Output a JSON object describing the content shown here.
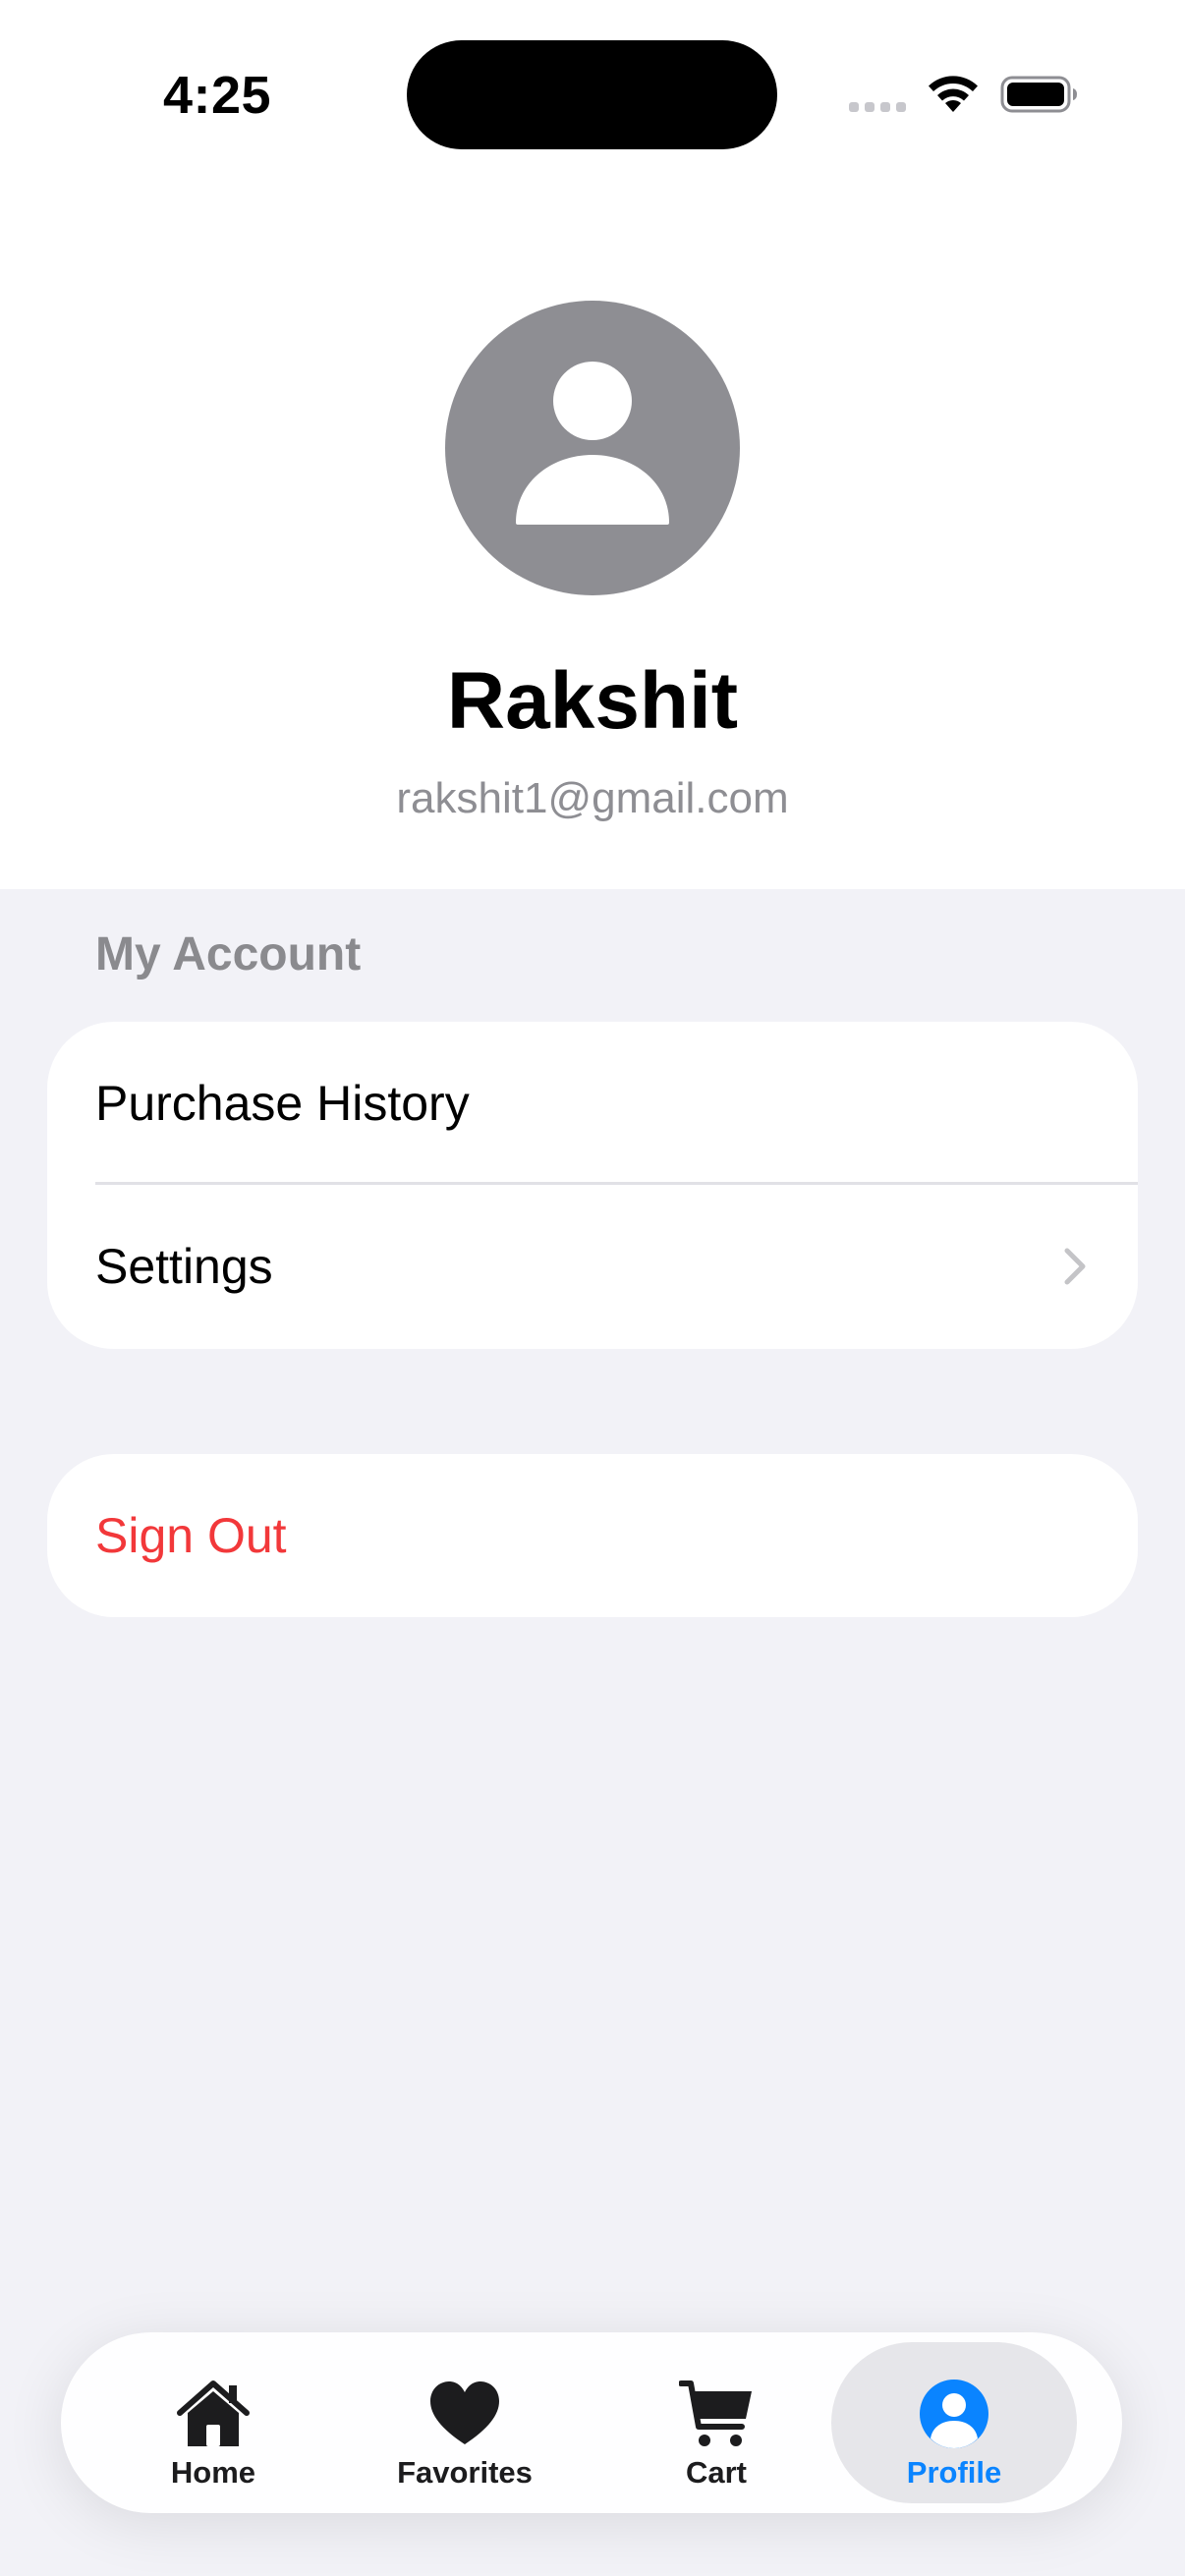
{
  "status_bar": {
    "time": "4:25"
  },
  "profile": {
    "name": "Rakshit",
    "email": "rakshit1@gmail.com",
    "avatar_icon": "person-circle-icon"
  },
  "sections": {
    "account": {
      "header": "My Account",
      "items": [
        {
          "label": "Purchase History"
        },
        {
          "label": "Settings",
          "icon": "chevron-right-icon"
        }
      ]
    },
    "sign_out": {
      "label": "Sign Out",
      "color": "#F2383A"
    }
  },
  "tab_bar": {
    "active_color": "#0A84FF",
    "tabs": [
      {
        "label": "Home",
        "icon": "house-icon"
      },
      {
        "label": "Favorites",
        "icon": "heart-icon"
      },
      {
        "label": "Cart",
        "icon": "cart-icon"
      },
      {
        "label": "Profile",
        "icon": "person-circle-icon",
        "active": true
      }
    ]
  }
}
